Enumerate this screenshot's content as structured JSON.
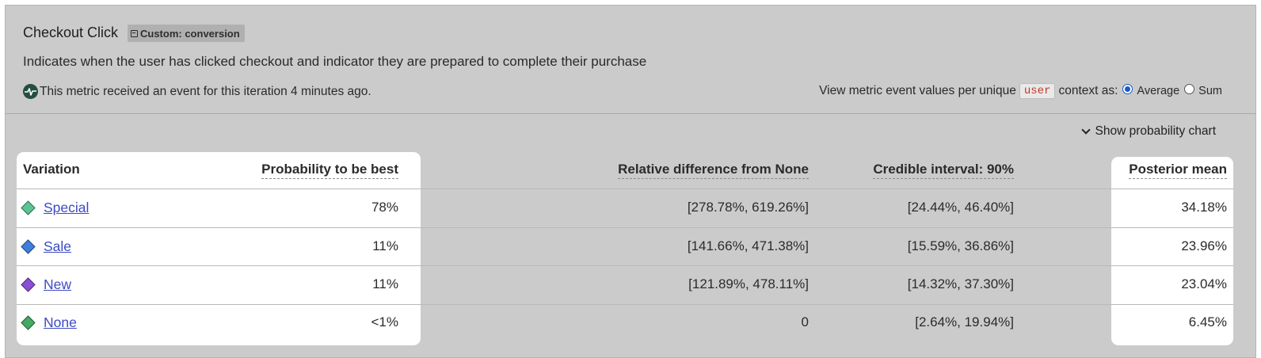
{
  "metric": {
    "title": "Checkout Click",
    "badge": "Custom: conversion",
    "description": "Indicates when the user has clicked checkout and indicator they are prepared to complete their purchase",
    "status": "This metric received an event for this iteration 4 minutes ago.",
    "context_prefix": "View metric event values per unique",
    "context_key": "user",
    "context_suffix": "context as:",
    "radio_options": [
      "Average",
      "Sum"
    ],
    "selected_option": "Average"
  },
  "show_chart_label": "Show probability chart",
  "table": {
    "headers": {
      "variation": "Variation",
      "probability": "Probability to be best",
      "relative": "Relative difference from None",
      "credible": "Credible interval: 90%",
      "posterior": "Posterior mean"
    },
    "rows": [
      {
        "name": "Special",
        "color": "#5cc493",
        "probability": "78%",
        "relative": "[278.78%, 619.26%]",
        "credible": "[24.44%, 46.40%]",
        "posterior": "34.18%"
      },
      {
        "name": "Sale",
        "color": "#3e7fdc",
        "probability": "11%",
        "relative": "[141.66%, 471.38%]",
        "credible": "[15.59%, 36.86%]",
        "posterior": "23.96%"
      },
      {
        "name": "New",
        "color": "#8a4fd4",
        "probability": "11%",
        "relative": "[121.89%, 478.11%]",
        "credible": "[14.32%, 37.30%]",
        "posterior": "23.04%"
      },
      {
        "name": "None",
        "color": "#45a863",
        "probability": "<1%",
        "relative": "0",
        "credible": "[2.64%, 19.94%]",
        "posterior": "6.45%"
      }
    ]
  }
}
